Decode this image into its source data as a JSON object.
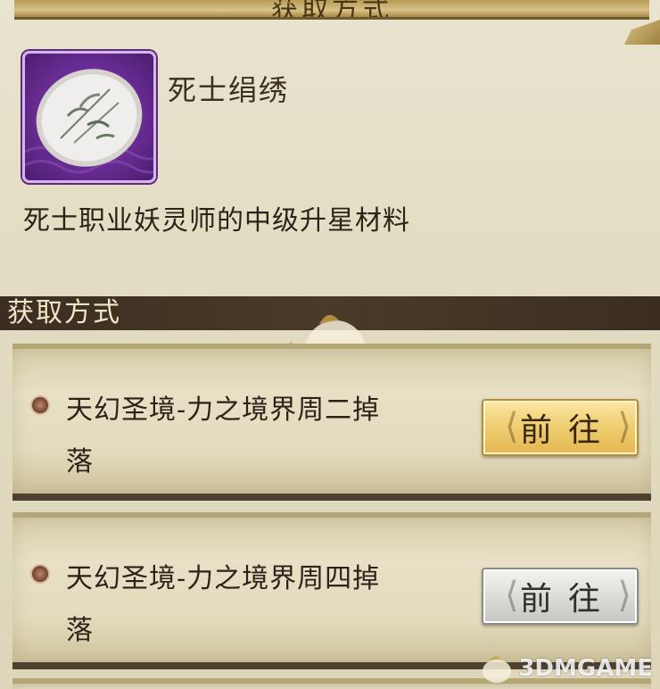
{
  "header": {
    "title": "获取方式"
  },
  "item": {
    "name": "死士绢绣",
    "description": "死士职业妖灵师的中级升星材料",
    "rarity_color": "#7b3aa8"
  },
  "section": {
    "label": "获取方式"
  },
  "sources": [
    {
      "text": "天幻圣境-力之境界周二掉落",
      "button_label": "前往",
      "button_state": "available",
      "button_color": "#f0cf74"
    },
    {
      "text": "天幻圣境-力之境界周四掉落",
      "button_label": "前往",
      "button_state": "unavailable",
      "button_color": "#dadad6"
    }
  ],
  "watermark": {
    "text": "3DMGAME"
  }
}
